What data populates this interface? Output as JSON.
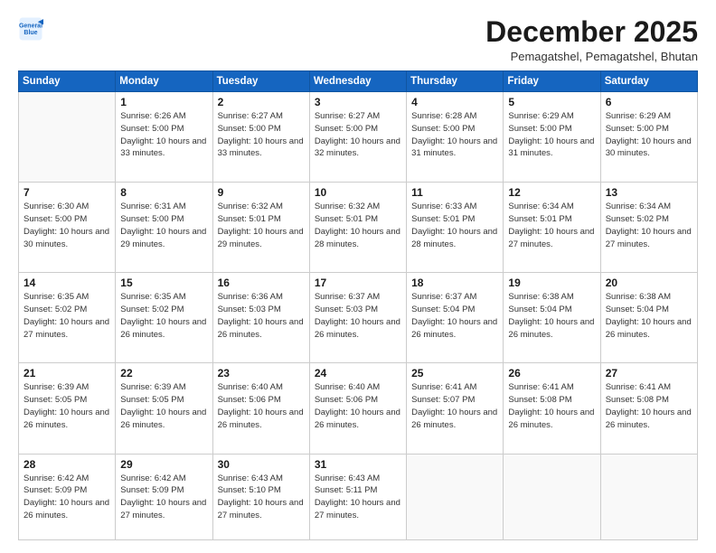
{
  "logo": {
    "line1": "General",
    "line2": "Blue"
  },
  "title": "December 2025",
  "location": "Pemagatshel, Pemagatshel, Bhutan",
  "days": [
    "Sunday",
    "Monday",
    "Tuesday",
    "Wednesday",
    "Thursday",
    "Friday",
    "Saturday"
  ],
  "weeks": [
    [
      {
        "date": "",
        "info": ""
      },
      {
        "date": "1",
        "info": "Sunrise: 6:26 AM\nSunset: 5:00 PM\nDaylight: 10 hours\nand 33 minutes."
      },
      {
        "date": "2",
        "info": "Sunrise: 6:27 AM\nSunset: 5:00 PM\nDaylight: 10 hours\nand 33 minutes."
      },
      {
        "date": "3",
        "info": "Sunrise: 6:27 AM\nSunset: 5:00 PM\nDaylight: 10 hours\nand 32 minutes."
      },
      {
        "date": "4",
        "info": "Sunrise: 6:28 AM\nSunset: 5:00 PM\nDaylight: 10 hours\nand 31 minutes."
      },
      {
        "date": "5",
        "info": "Sunrise: 6:29 AM\nSunset: 5:00 PM\nDaylight: 10 hours\nand 31 minutes."
      },
      {
        "date": "6",
        "info": "Sunrise: 6:29 AM\nSunset: 5:00 PM\nDaylight: 10 hours\nand 30 minutes."
      }
    ],
    [
      {
        "date": "7",
        "info": "Sunrise: 6:30 AM\nSunset: 5:00 PM\nDaylight: 10 hours\nand 30 minutes."
      },
      {
        "date": "8",
        "info": "Sunrise: 6:31 AM\nSunset: 5:00 PM\nDaylight: 10 hours\nand 29 minutes."
      },
      {
        "date": "9",
        "info": "Sunrise: 6:32 AM\nSunset: 5:01 PM\nDaylight: 10 hours\nand 29 minutes."
      },
      {
        "date": "10",
        "info": "Sunrise: 6:32 AM\nSunset: 5:01 PM\nDaylight: 10 hours\nand 28 minutes."
      },
      {
        "date": "11",
        "info": "Sunrise: 6:33 AM\nSunset: 5:01 PM\nDaylight: 10 hours\nand 28 minutes."
      },
      {
        "date": "12",
        "info": "Sunrise: 6:34 AM\nSunset: 5:01 PM\nDaylight: 10 hours\nand 27 minutes."
      },
      {
        "date": "13",
        "info": "Sunrise: 6:34 AM\nSunset: 5:02 PM\nDaylight: 10 hours\nand 27 minutes."
      }
    ],
    [
      {
        "date": "14",
        "info": "Sunrise: 6:35 AM\nSunset: 5:02 PM\nDaylight: 10 hours\nand 27 minutes."
      },
      {
        "date": "15",
        "info": "Sunrise: 6:35 AM\nSunset: 5:02 PM\nDaylight: 10 hours\nand 26 minutes."
      },
      {
        "date": "16",
        "info": "Sunrise: 6:36 AM\nSunset: 5:03 PM\nDaylight: 10 hours\nand 26 minutes."
      },
      {
        "date": "17",
        "info": "Sunrise: 6:37 AM\nSunset: 5:03 PM\nDaylight: 10 hours\nand 26 minutes."
      },
      {
        "date": "18",
        "info": "Sunrise: 6:37 AM\nSunset: 5:04 PM\nDaylight: 10 hours\nand 26 minutes."
      },
      {
        "date": "19",
        "info": "Sunrise: 6:38 AM\nSunset: 5:04 PM\nDaylight: 10 hours\nand 26 minutes."
      },
      {
        "date": "20",
        "info": "Sunrise: 6:38 AM\nSunset: 5:04 PM\nDaylight: 10 hours\nand 26 minutes."
      }
    ],
    [
      {
        "date": "21",
        "info": "Sunrise: 6:39 AM\nSunset: 5:05 PM\nDaylight: 10 hours\nand 26 minutes."
      },
      {
        "date": "22",
        "info": "Sunrise: 6:39 AM\nSunset: 5:05 PM\nDaylight: 10 hours\nand 26 minutes."
      },
      {
        "date": "23",
        "info": "Sunrise: 6:40 AM\nSunset: 5:06 PM\nDaylight: 10 hours\nand 26 minutes."
      },
      {
        "date": "24",
        "info": "Sunrise: 6:40 AM\nSunset: 5:06 PM\nDaylight: 10 hours\nand 26 minutes."
      },
      {
        "date": "25",
        "info": "Sunrise: 6:41 AM\nSunset: 5:07 PM\nDaylight: 10 hours\nand 26 minutes."
      },
      {
        "date": "26",
        "info": "Sunrise: 6:41 AM\nSunset: 5:08 PM\nDaylight: 10 hours\nand 26 minutes."
      },
      {
        "date": "27",
        "info": "Sunrise: 6:41 AM\nSunset: 5:08 PM\nDaylight: 10 hours\nand 26 minutes."
      }
    ],
    [
      {
        "date": "28",
        "info": "Sunrise: 6:42 AM\nSunset: 5:09 PM\nDaylight: 10 hours\nand 26 minutes."
      },
      {
        "date": "29",
        "info": "Sunrise: 6:42 AM\nSunset: 5:09 PM\nDaylight: 10 hours\nand 27 minutes."
      },
      {
        "date": "30",
        "info": "Sunrise: 6:43 AM\nSunset: 5:10 PM\nDaylight: 10 hours\nand 27 minutes."
      },
      {
        "date": "31",
        "info": "Sunrise: 6:43 AM\nSunset: 5:11 PM\nDaylight: 10 hours\nand 27 minutes."
      },
      {
        "date": "",
        "info": ""
      },
      {
        "date": "",
        "info": ""
      },
      {
        "date": "",
        "info": ""
      }
    ]
  ]
}
